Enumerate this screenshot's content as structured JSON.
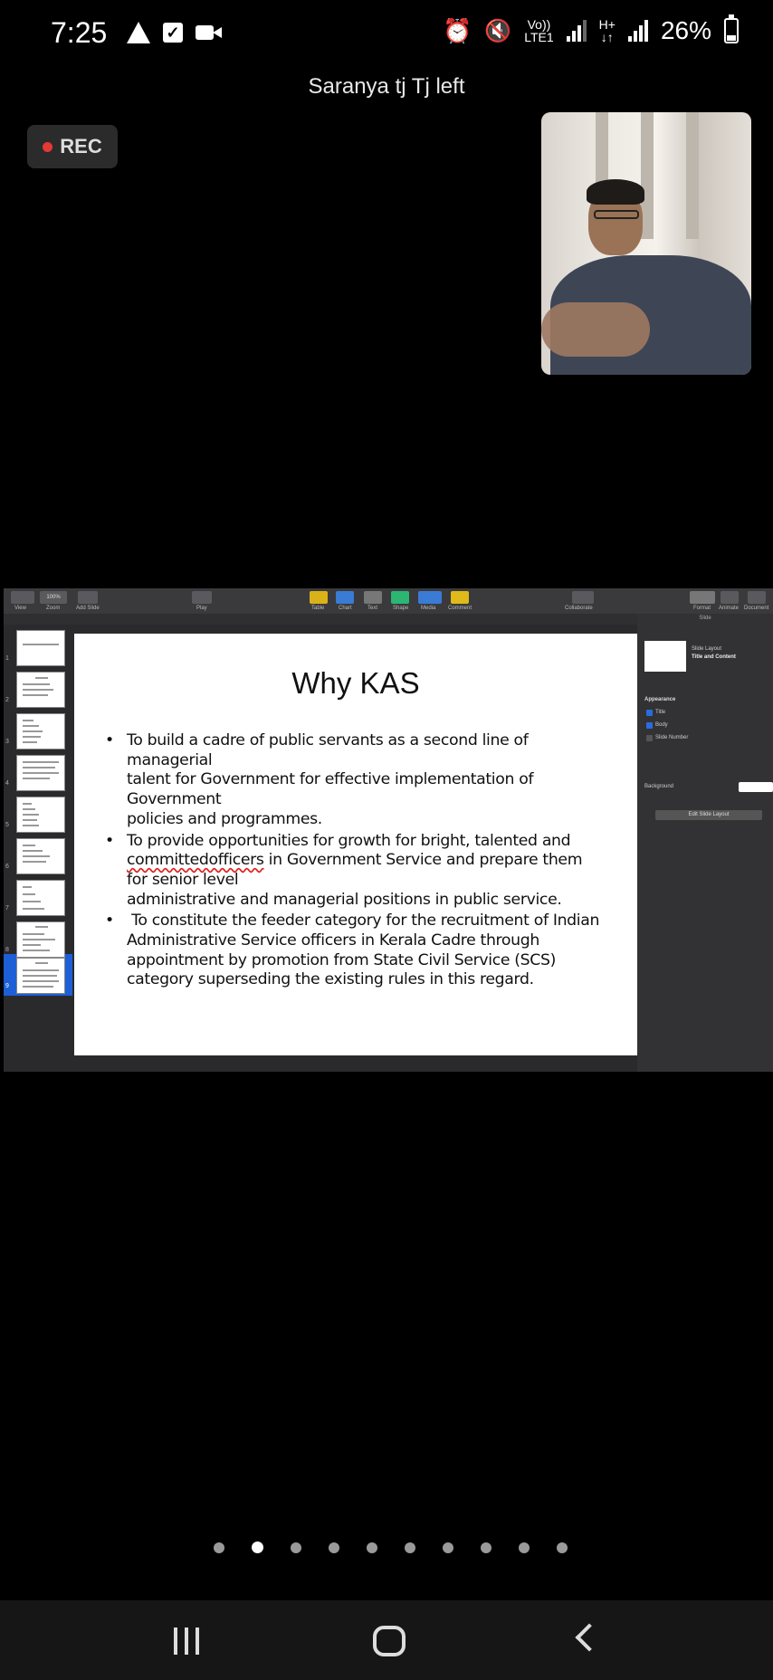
{
  "status_bar": {
    "time": "7:25",
    "network_top": "Vo))",
    "network_bottom": "LTE1",
    "hplus_top": "H+",
    "hplus_bottom": "↓↑",
    "battery": "26%"
  },
  "meeting": {
    "notification": "Saranya tj Tj left",
    "rec_label": "REC"
  },
  "keynote": {
    "toolbar": {
      "view": "View",
      "zoom": "Zoom",
      "add_slide": "Add Slide",
      "play": "Play",
      "table": "Table",
      "chart": "Chart",
      "text": "Text",
      "shape": "Shape",
      "media": "Media",
      "comment": "Comment",
      "collaborate": "Collaborate",
      "format": "Format",
      "animate": "Animate",
      "document": "Document",
      "zoom_value": "100%"
    },
    "slide": {
      "title": "Why KAS",
      "bullets": [
        {
          "lines": [
            "To build a cadre of public servants as a second line of",
            "managerial",
            "talent for Government for effective implementation of",
            "Government",
            "policies and programmes."
          ]
        },
        {
          "line1": "To provide opportunities for growth for bright, talented and",
          "line2_misspelled": "committedofficers",
          "line2_rest": " in Government Service and prepare them",
          "line3": "for senior level",
          "line4": "administrative and managerial positions in public service."
        },
        {
          "lines": [
            " To constitute the feeder category for the recruitment of Indian",
            "Administrative Service officers in Kerala Cadre through",
            "appointment by promotion from State Civil Service (SCS)",
            "category superseding the existing rules in this regard."
          ]
        }
      ]
    },
    "thumbnail_numbers": [
      "1",
      "2",
      "3",
      "4",
      "5",
      "6",
      "7",
      "8",
      "9"
    ],
    "active_slide": 9,
    "inspector": {
      "tab": "Slide",
      "slide_layout_label": "Slide Layout",
      "slide_layout_value": "Title and Content",
      "appearance": "Appearance",
      "title_opt": "Title",
      "body_opt": "Body",
      "slide_number_opt": "Slide Number",
      "background": "Background",
      "edit_layout": "Edit Slide Layout"
    }
  },
  "pager": {
    "count": 10,
    "active_index": 1
  }
}
